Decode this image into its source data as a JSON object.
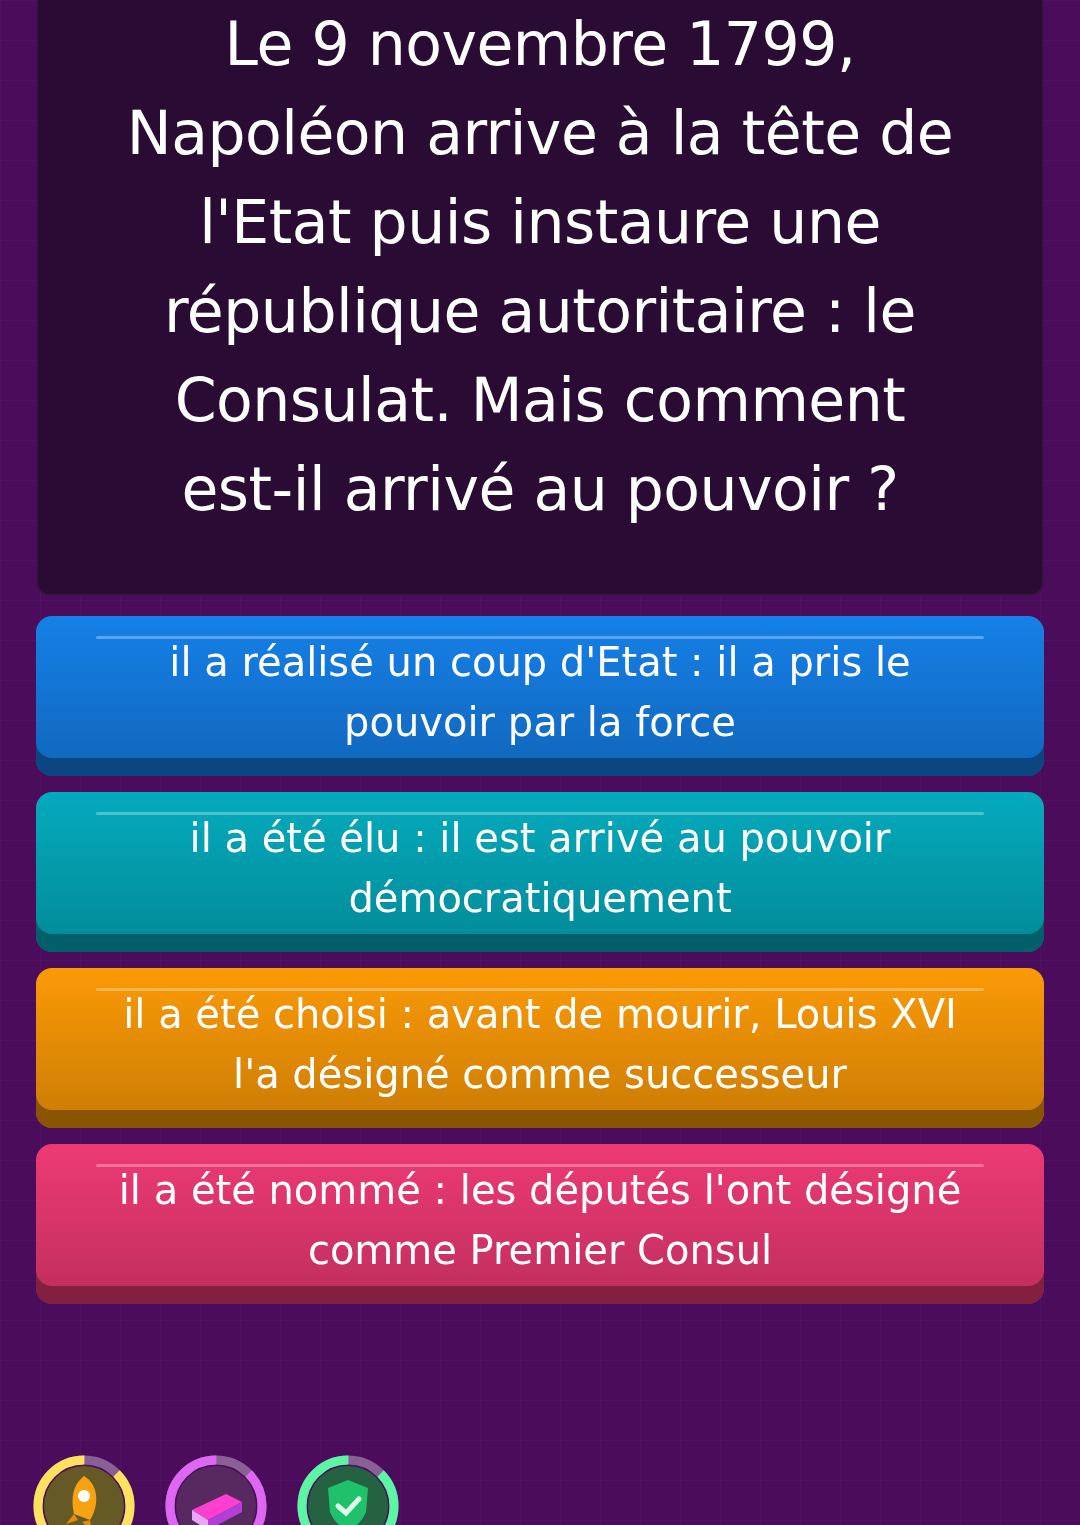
{
  "question": "Le 9 novembre 1799, Napoléon arrive à la tête de l'Etat puis instaure une république autoritaire : le Consulat. Mais comment est-il arrivé au pouvoir ?",
  "answers": [
    {
      "text": "il a réalisé un coup d'Etat : il a pris le pouvoir par la force",
      "color": "#1580e8"
    },
    {
      "text": "il a été élu : il est arrivé au pouvoir démocratiquement",
      "color": "#04abbd"
    },
    {
      "text": "il a été choisi : avant de mourir, Louis XVI l'a désigné comme successeur",
      "color": "#fb9a06"
    },
    {
      "text": "il a été nommé : les députés l'ont désigné comme Premier Consul",
      "color": "#ee3a74"
    }
  ],
  "power_ups": [
    {
      "kind": "rocket",
      "color": "#fde25f"
    },
    {
      "kind": "eraser",
      "color": "#dd66f2"
    },
    {
      "kind": "shield",
      "color": "#5cf5a3"
    }
  ]
}
